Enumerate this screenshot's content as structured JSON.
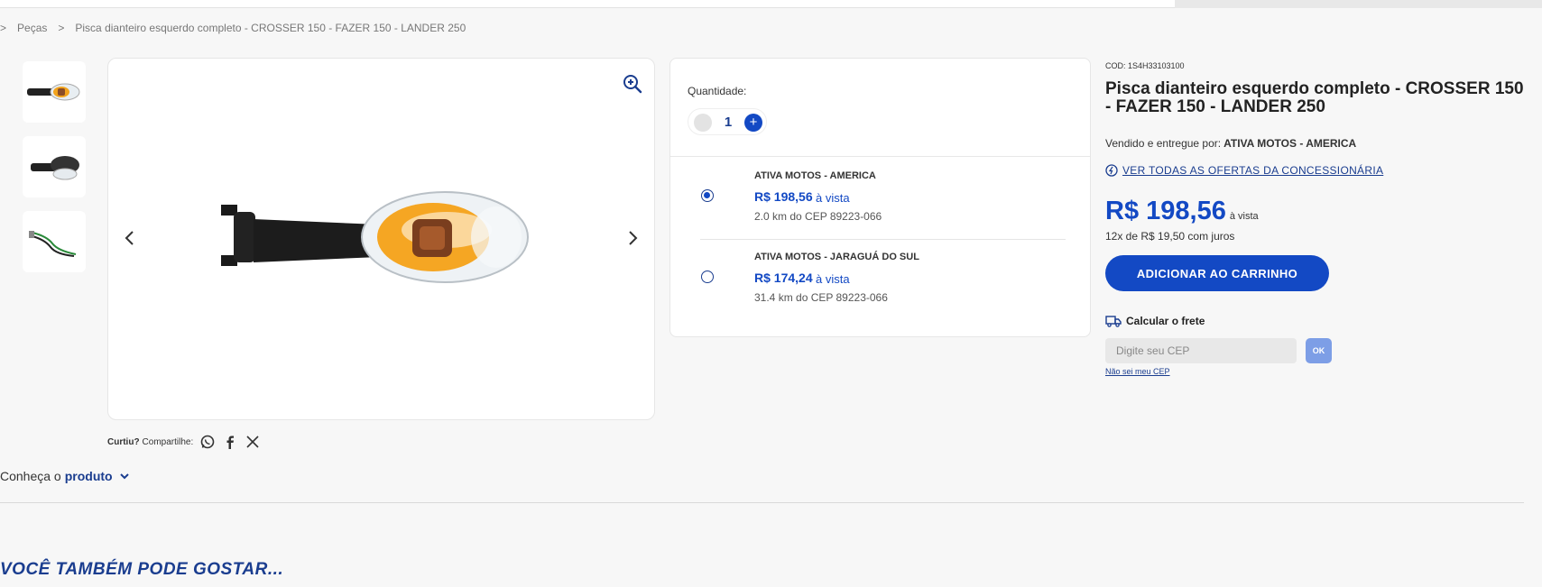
{
  "breadcrumb": {
    "sep1": ">",
    "parts_label": "Peças",
    "sep2": ">",
    "current": "Pisca dianteiro esquerdo completo - CROSSER 150 - FAZER 150 - LANDER 250"
  },
  "share": {
    "curtiu": "Curtiu?",
    "label": "Compartilhe:"
  },
  "conheca": {
    "prefix": "Conheça o",
    "bold": "produto"
  },
  "also_like": "VOCÊ TAMBÉM PODE GOSTAR...",
  "quantity": {
    "label": "Quantidade:",
    "value": "1",
    "plus": "+"
  },
  "offers": [
    {
      "dealer": "ATIVA MOTOS - AMERICA",
      "price": "R$ 198,56",
      "payment": "à vista",
      "distance": "2.0 km do CEP 89223-066",
      "selected": true
    },
    {
      "dealer": "ATIVA MOTOS - JARAGUÁ DO SUL",
      "price": "R$ 174,24",
      "payment": "à vista",
      "distance": "31.4 km do CEP 89223-066",
      "selected": false
    }
  ],
  "product": {
    "code": "COD: 1S4H33103100",
    "title": "Pisca dianteiro esquerdo completo - CROSSER 150 - FAZER 150 - LANDER 250",
    "sold_by_label": "Vendido e entregue por:",
    "sold_by": "ATIVA MOTOS - AMERICA",
    "all_offers_link": "VER TODAS AS OFERTAS DA CONCESSIONÁRIA",
    "price": "R$ 198,56",
    "price_suffix": "à vista",
    "installments": "12x de R$ 19,50 com juros",
    "add_to_cart": "ADICIONAR AO CARRINHO"
  },
  "freight": {
    "label": "Calcular o frete",
    "cep_placeholder": "Digite seu CEP",
    "ok": "OK",
    "no_cep": "Não sei meu CEP"
  },
  "colors": {
    "accent": "#1349c4",
    "brand_dark": "#1a3d8f"
  },
  "icons": [
    "zoom-in-icon",
    "chevron-left-icon",
    "chevron-right-icon",
    "whatsapp-icon",
    "facebook-icon",
    "x-twitter-icon",
    "chevron-down-icon",
    "offers-badge-icon",
    "truck-icon"
  ]
}
